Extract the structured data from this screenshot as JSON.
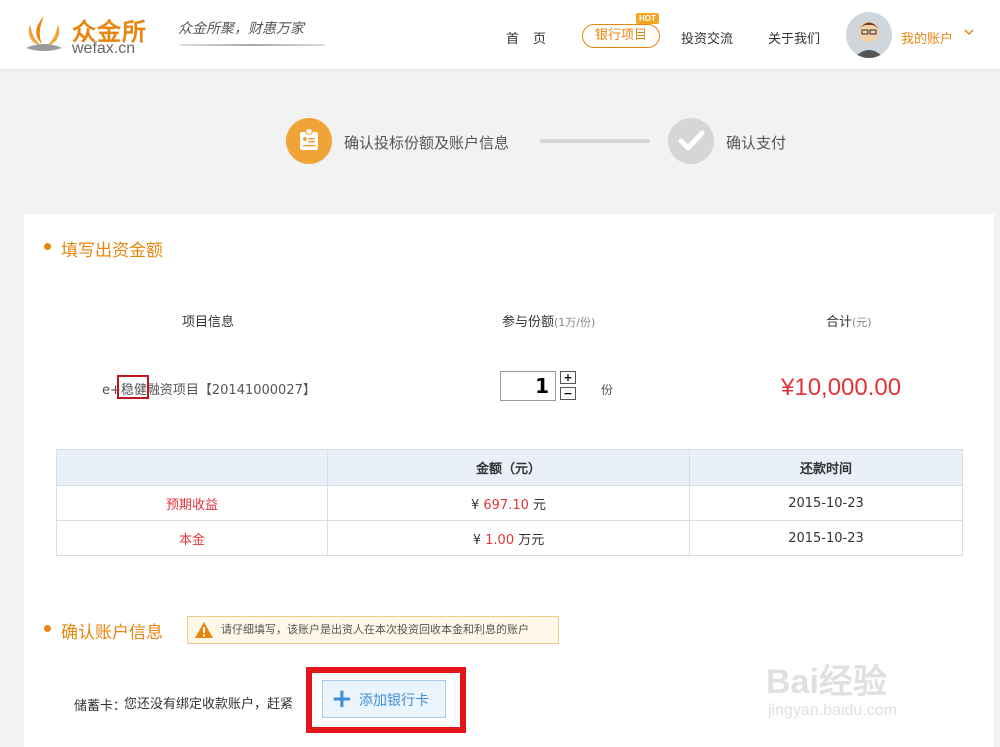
{
  "header": {
    "logo_cn": "众金所",
    "logo_en": "wefax.cn",
    "slogan": "众金所聚，财惠万家",
    "nav": {
      "home": "首页",
      "bank_projects": "银行项目",
      "hot": "HOT",
      "invest_exchange": "投资交流",
      "about": "关于我们"
    },
    "account": "我的账户",
    "colors": {
      "brand": "#e8850f"
    }
  },
  "steps": {
    "step1": "确认投标份额及账户信息",
    "step2": "确认支付"
  },
  "section1": {
    "title": "填写出资金额",
    "columns": {
      "project_info": "项目信息",
      "shares": "参与份额",
      "shares_unit": "(1万/份)",
      "total": "合计",
      "total_unit": "(元)"
    },
    "project_name": "e+稳健融资项目【20141000027】",
    "quantity": "1",
    "qty_plus": "+",
    "qty_minus": "−",
    "qty_unit": "份",
    "total_amount": "¥10,000.00"
  },
  "returns_table": {
    "headers": [
      "",
      "金额（元）",
      "还款时间"
    ],
    "rows": [
      {
        "label": "预期收益",
        "prefix": "¥",
        "amount": "697.10",
        "unit": "元",
        "date": "2015-10-23"
      },
      {
        "label": "本金",
        "prefix": "¥",
        "amount": "1.00",
        "unit": "万元",
        "date": "2015-10-23"
      }
    ]
  },
  "section2": {
    "title": "确认账户信息",
    "warning": "请仔细填写，该账户是出资人在本次投资回收本金和利息的账户",
    "card_label": "储蓄卡：",
    "card_hint": "您还没有绑定收款账户，赶紧",
    "add_card": "添加银行卡",
    "plus": "+"
  },
  "watermark": {
    "logo": "Bai经验",
    "url": "jingyan.baidu.com"
  }
}
